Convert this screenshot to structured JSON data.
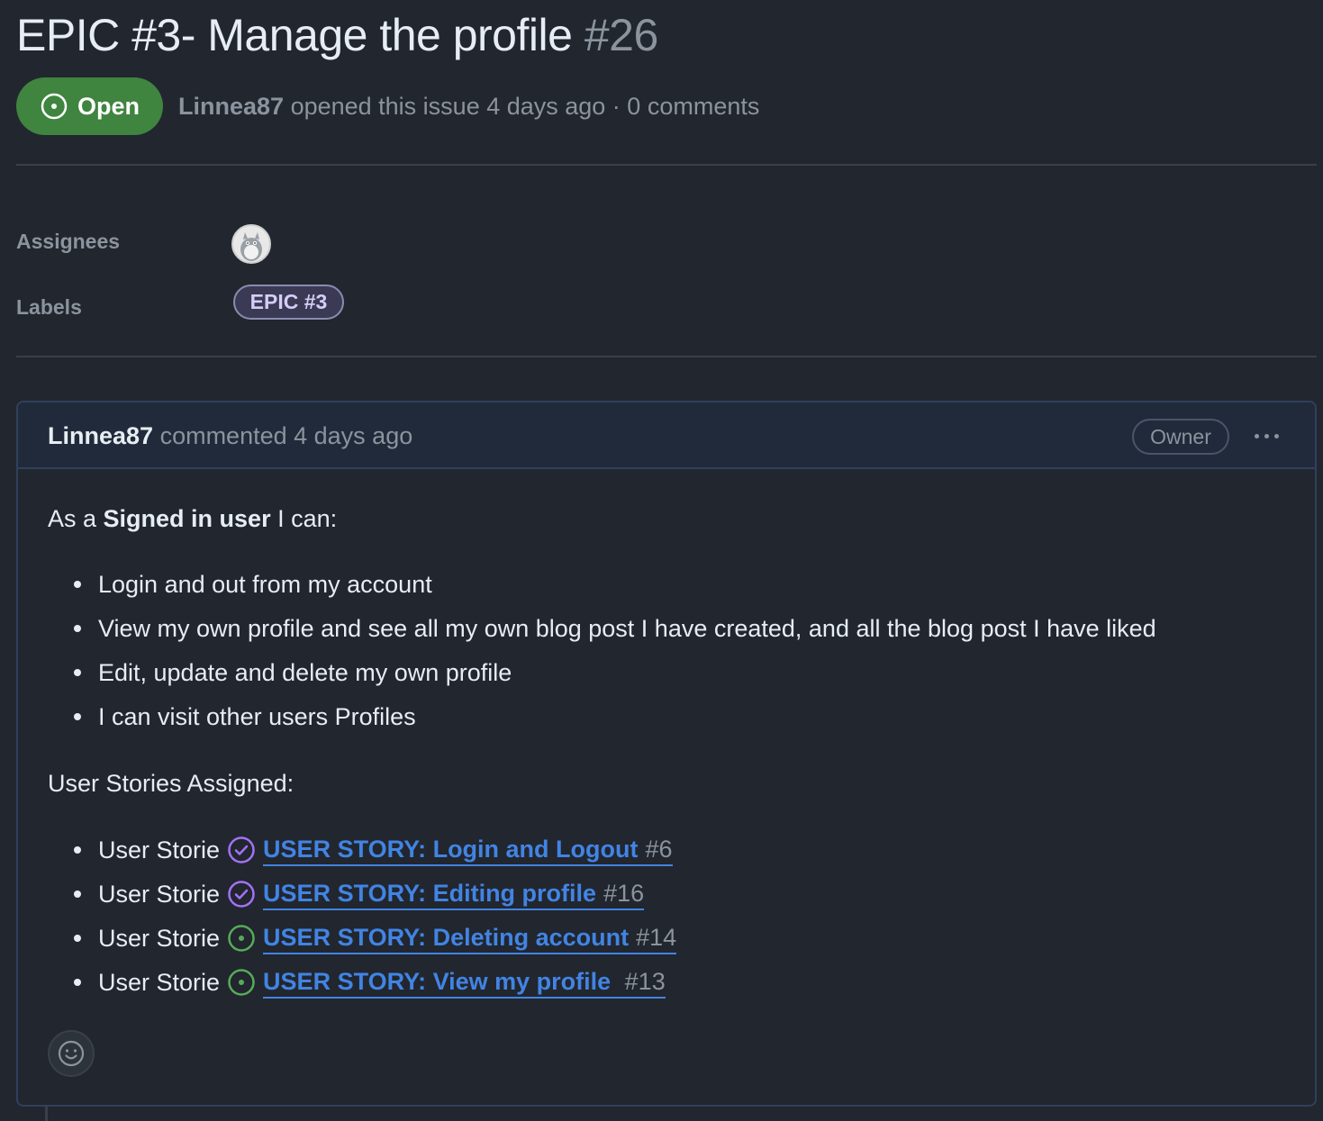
{
  "issue": {
    "title": "EPIC #3- Manage the profile",
    "number": "#26",
    "state": "Open",
    "author": "Linnea87",
    "meta_text": "opened this issue 4 days ago · 0 comments"
  },
  "sidebar": {
    "assignees_label": "Assignees",
    "labels_label": "Labels",
    "label_chip": "EPIC #3"
  },
  "comment": {
    "author": "Linnea87",
    "action": "commented 4 days ago",
    "role_badge": "Owner",
    "intro_pre": "As a",
    "intro_bold": "Signed in user",
    "intro_post": "I can:",
    "bullets": [
      "Login and out from my account",
      "View my own profile and see all my own blog post I have created, and all the blog post I have liked",
      "Edit, update and delete my own profile",
      "I can visit other users Profiles"
    ],
    "stories_heading": "User Stories Assigned:",
    "stories": [
      {
        "prefix": "User Storie",
        "state": "closed",
        "title": "USER STORY: Login and Logout",
        "number": "#6"
      },
      {
        "prefix": "User Storie",
        "state": "closed",
        "title": "USER STORY: Editing profile",
        "number": "#16"
      },
      {
        "prefix": "User Storie",
        "state": "open",
        "title": "USER STORY: Deleting account",
        "number": "#14"
      },
      {
        "prefix": "User Storie",
        "state": "open",
        "title": "USER STORY: View my profile ",
        "number": "#13"
      }
    ]
  },
  "colors": {
    "open_green": "#3f843f",
    "link_blue": "#4184e4",
    "closed_purple": "#a371f7",
    "open_icon_green": "#57ab5a"
  }
}
